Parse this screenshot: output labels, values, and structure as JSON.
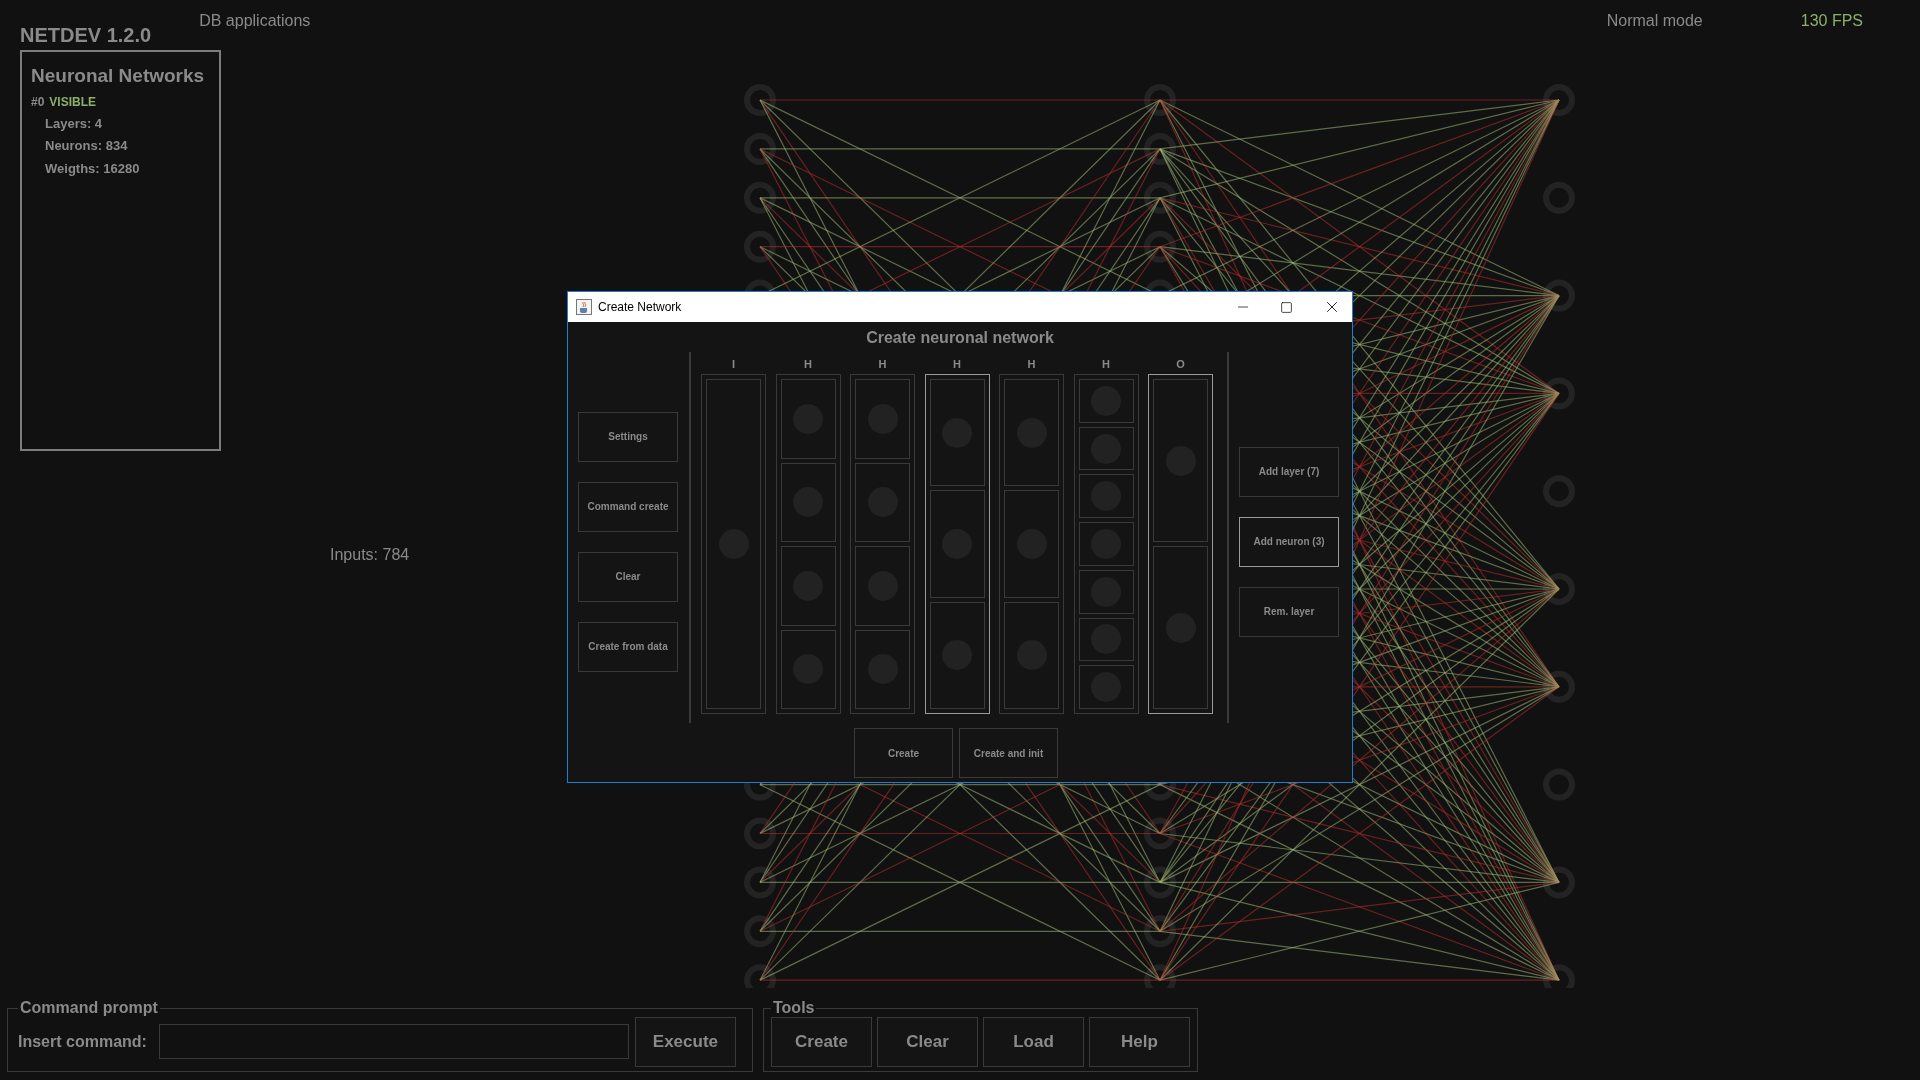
{
  "app": {
    "title": "NETDEV 1.2.0",
    "menu": "DB applications",
    "mode": "Normal mode",
    "fps": "130 FPS"
  },
  "networks_panel": {
    "title": "Neuronal Networks",
    "index": "#0",
    "status": "VISIBLE",
    "stats": [
      "Layers: 4",
      "Neurons: 834",
      "Weigths: 16280"
    ]
  },
  "inputs_label": "Inputs: 784",
  "dialog": {
    "title": "Create Network",
    "heading": "Create neuronal network",
    "left_buttons": [
      "Settings",
      "Command create",
      "Clear",
      "Create from data"
    ],
    "layers": [
      {
        "label": "I",
        "selected": false,
        "neurons": [
          {
            "kind": "neuron"
          }
        ]
      },
      {
        "label": "H",
        "selected": false,
        "neurons": [
          {
            "kind": "neuron"
          },
          {
            "kind": "neuron"
          },
          {
            "kind": "neuron"
          },
          {
            "kind": "neuron"
          }
        ]
      },
      {
        "label": "H",
        "selected": false,
        "neurons": [
          {
            "kind": "neuron"
          },
          {
            "kind": "neuron"
          },
          {
            "kind": "neuron"
          },
          {
            "kind": "neuron"
          }
        ]
      },
      {
        "label": "H",
        "selected": true,
        "neurons": [
          {
            "kind": "neuron"
          },
          {
            "kind": "neuron"
          },
          {
            "kind": "neuron"
          }
        ]
      },
      {
        "label": "H",
        "selected": false,
        "neurons": [
          {
            "kind": "neuron"
          },
          {
            "kind": "neuron"
          },
          {
            "kind": "neuron"
          }
        ]
      },
      {
        "label": "H",
        "selected": false,
        "neurons": [
          {
            "kind": "neuron"
          },
          {
            "kind": "neuron"
          },
          {
            "kind": "neuron"
          },
          {
            "kind": "neuron"
          },
          {
            "kind": "neuron"
          },
          {
            "kind": "neuron"
          },
          {
            "kind": "neuron"
          }
        ]
      },
      {
        "label": "O",
        "selected": true,
        "neurons": [
          {
            "kind": "neuron"
          },
          {
            "kind": "neuron"
          }
        ]
      }
    ],
    "right_buttons": [
      {
        "label": "Add layer (7)",
        "focused": false
      },
      {
        "label": "Add neuron (3)",
        "focused": true
      },
      {
        "label": "Rem. layer",
        "focused": false
      }
    ],
    "bottom_buttons": [
      "Create",
      "Create and init"
    ]
  },
  "command_prompt": {
    "legend": "Command prompt",
    "label": "Insert command:",
    "button": "Execute"
  },
  "tools": {
    "legend": "Tools",
    "buttons": [
      "Create",
      "Clear",
      "Load",
      "Help"
    ]
  }
}
